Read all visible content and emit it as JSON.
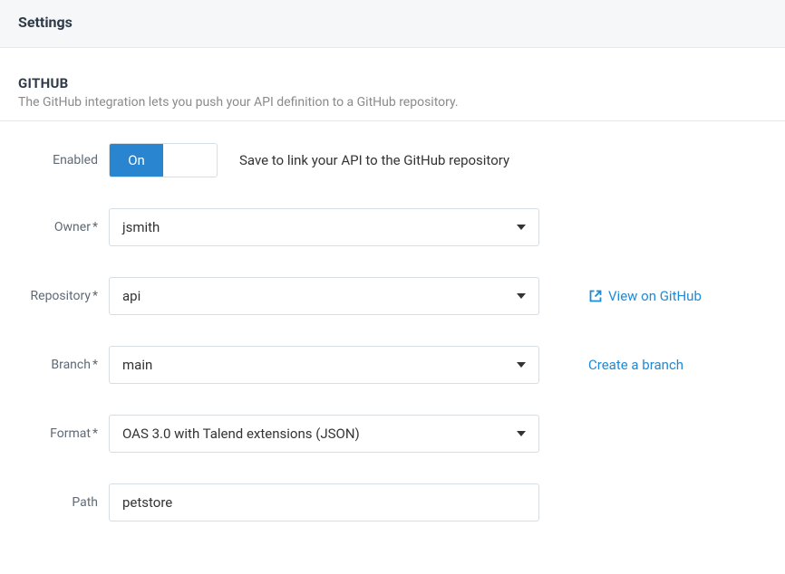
{
  "header": {
    "title": "Settings"
  },
  "section": {
    "title": "GITHUB",
    "description": "The GitHub integration lets you push your API definition to a GitHub repository."
  },
  "form": {
    "enabled": {
      "label": "Enabled",
      "on_label": "On",
      "hint": "Save to link your API to the GitHub repository"
    },
    "owner": {
      "label": "Owner",
      "required": "*",
      "value": "jsmith"
    },
    "repository": {
      "label": "Repository",
      "required": "*",
      "value": "api",
      "link_label": "View on GitHub"
    },
    "branch": {
      "label": "Branch",
      "required": "*",
      "value": "main",
      "link_label": "Create a branch"
    },
    "format": {
      "label": "Format",
      "required": "*",
      "value": "OAS 3.0 with Talend extensions (JSON)"
    },
    "path": {
      "label": "Path",
      "value": "petstore"
    }
  }
}
